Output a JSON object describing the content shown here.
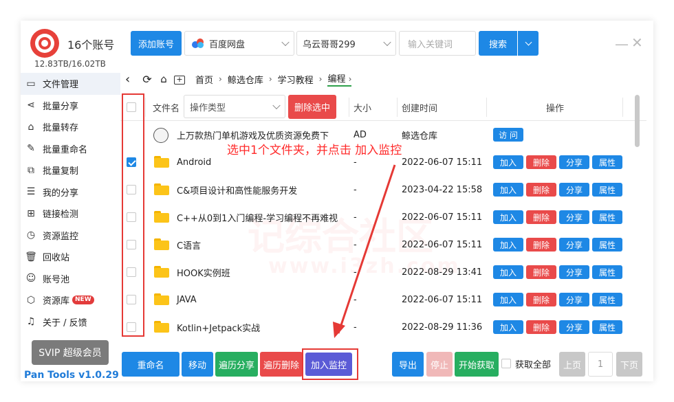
{
  "app": {
    "account_count": "16个账号",
    "storage": "12.83TB/16.02TB",
    "version": "Pan Tools v1.0.29",
    "svip": "SVIP 超级会员"
  },
  "sidebar": {
    "items": [
      {
        "label": "文件管理",
        "icon": "folder-icon"
      },
      {
        "label": "批量分享",
        "icon": "share-icon"
      },
      {
        "label": "批量转存",
        "icon": "transfer-icon"
      },
      {
        "label": "批量重命名",
        "icon": "rename-icon"
      },
      {
        "label": "批量复制",
        "icon": "copy-icon"
      },
      {
        "label": "我的分享",
        "icon": "my-share-icon"
      },
      {
        "label": "链接检测",
        "icon": "link-check-icon"
      },
      {
        "label": "资源监控",
        "icon": "monitor-icon"
      },
      {
        "label": "回收站",
        "icon": "trash-icon"
      },
      {
        "label": "账号池",
        "icon": "account-pool-icon"
      },
      {
        "label": "资源库",
        "icon": "library-icon",
        "badge": "NEW"
      },
      {
        "label": "关于 / 反馈",
        "icon": "bell-icon"
      }
    ]
  },
  "toolbar": {
    "add_account": "添加账号",
    "disk": "百度网盘",
    "account": "乌云哥哥299",
    "keyword_placeholder": "输入关键词",
    "search": "搜索"
  },
  "breadcrumb": [
    "首页",
    "鲸选仓库",
    "学习教程",
    "编程"
  ],
  "table": {
    "headers": {
      "name": "文件名",
      "op_type": "操作类型",
      "delete_selected": "删除选中",
      "size": "大小",
      "created": "创建时间",
      "actions": "操作"
    },
    "ad_row": {
      "name": "上万款热门单机游戏及优质资源免费下",
      "size": "AD",
      "created": "鲸选仓库",
      "action": "访 问"
    },
    "rows": [
      {
        "name": "Android",
        "size": "-",
        "created": "2022-06-07 15:11",
        "checked": true
      },
      {
        "name": "C&项目设计和高性能服务开发",
        "size": "-",
        "created": "2023-04-22 15:58",
        "checked": false
      },
      {
        "name": "C++从0到1入门编程-学习编程不再难视",
        "size": "-",
        "created": "2022-06-07 15:11",
        "checked": false
      },
      {
        "name": "C语言",
        "size": "-",
        "created": "2022-06-07 15:11",
        "checked": false
      },
      {
        "name": "HOOK实例班",
        "size": "-",
        "created": "2022-08-29 13:41",
        "checked": false
      },
      {
        "name": "JAVA",
        "size": "-",
        "created": "2022-06-07 15:11",
        "checked": false
      },
      {
        "name": "Kotlin+Jetpack实战",
        "size": "-",
        "created": "2022-08-29 11:36",
        "checked": false
      }
    ],
    "row_actions": {
      "add": "加入",
      "delete": "删除",
      "share": "分享",
      "props": "属性"
    }
  },
  "bottom": {
    "rename": "重命名",
    "move": "移动",
    "traverse_share": "遍历分享",
    "traverse_delete": "遍历删除",
    "add_monitor": "加入监控",
    "export": "导出",
    "stop": "停止",
    "start_fetch": "开始获取",
    "fetch_all": "获取全部",
    "prev": "上页",
    "page": "1",
    "next": "下页"
  },
  "annotation": "选中1个文件夹，并点击 加入监控",
  "watermark": {
    "main": "记综合社区",
    "url": "www.i3zh.com"
  },
  "colors": {
    "primary": "#1e88e5",
    "danger": "#e94a4a",
    "success": "#27ae60",
    "highlight": "#5b5bd6",
    "annotation": "#ff2a2a"
  }
}
